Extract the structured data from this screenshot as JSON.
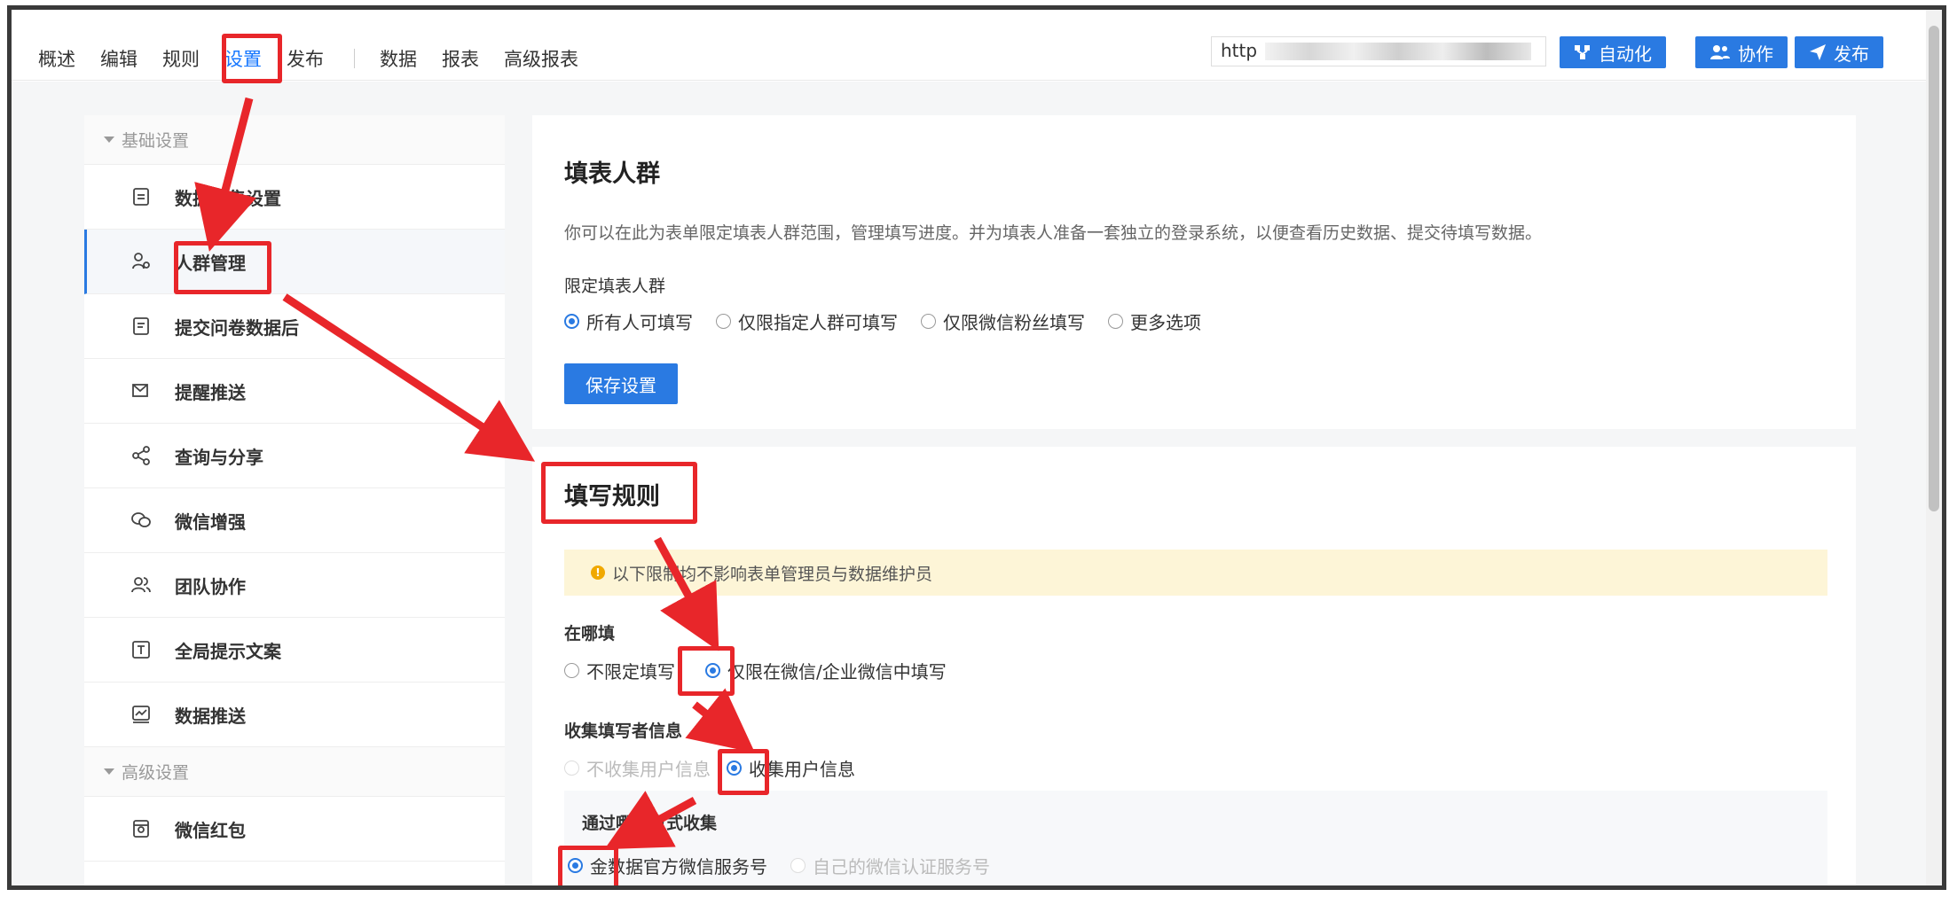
{
  "topnav": {
    "items": [
      "概述",
      "编辑",
      "规则",
      "设置",
      "发布"
    ],
    "items2": [
      "数据",
      "报表",
      "高级报表"
    ],
    "active_index": 3
  },
  "url": {
    "prefix": "http"
  },
  "buttons": {
    "automation": "自动化",
    "collaborate": "协作",
    "publish": "发布"
  },
  "sidebar": {
    "group1": "基础设置",
    "items": [
      {
        "label": "数据收集设置",
        "icon": "document-icon"
      },
      {
        "label": "人群管理",
        "icon": "user-group-icon"
      },
      {
        "label": "提交问卷数据后",
        "icon": "document-list-icon"
      },
      {
        "label": "提醒推送",
        "icon": "mail-send-icon"
      },
      {
        "label": "查询与分享",
        "icon": "share-icon"
      },
      {
        "label": "微信增强",
        "icon": "wechat-icon"
      },
      {
        "label": "团队协作",
        "icon": "team-icon"
      },
      {
        "label": "全局提示文案",
        "icon": "text-box-icon"
      },
      {
        "label": "数据推送",
        "icon": "chart-push-icon"
      }
    ],
    "group2": "高级设置",
    "items2": [
      {
        "label": "微信红包",
        "icon": "red-packet-icon"
      }
    ],
    "active_index": 1
  },
  "card1": {
    "title": "填表人群",
    "desc": "你可以在此为表单限定填表人群范围，管理填写进度。并为填表人准备一套独立的登录系统，以便查看历史数据、提交待填写数据。",
    "limit_label": "限定填表人群",
    "options": [
      "所有人可填写",
      "仅限指定人群可填写",
      "仅限微信粉丝填写",
      "更多选项"
    ],
    "save": "保存设置"
  },
  "card2": {
    "title": "填写规则",
    "notice": "以下限制均不影响表单管理员与数据维护员",
    "where_label": "在哪填",
    "where_options": [
      "不限定填写",
      "仅限在微信/企业微信中填写"
    ],
    "collect_label": "收集填写者信息",
    "collect_options": [
      "不收集用户信息",
      "收集用户信息"
    ],
    "method_label": "通过哪种方式收集",
    "method_options": [
      "金数据官方微信服务号",
      "自己的微信认证服务号"
    ]
  },
  "colors": {
    "accent": "#2a7ae2",
    "annotation": "#e8262a",
    "notice_bg": "#fdf5d7"
  }
}
